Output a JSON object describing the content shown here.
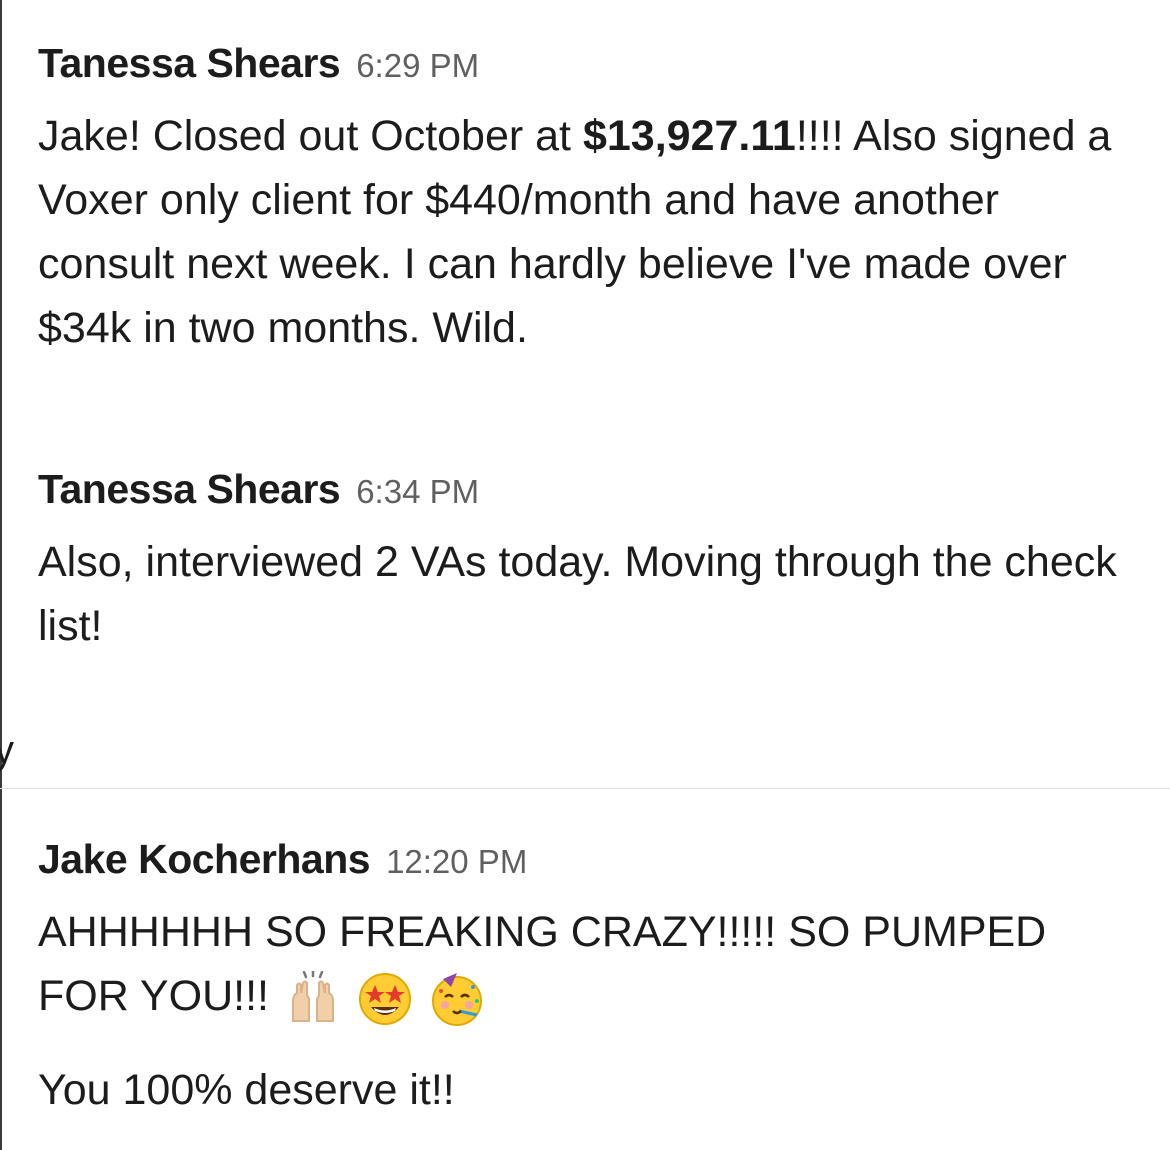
{
  "messages": [
    {
      "author": "Tanessa Shears",
      "time": "6:29 PM",
      "text_before_bold": "Jake! Closed out October at ",
      "bold_amount": "$13,927.11",
      "text_after_bold": "!!!! Also signed a Voxer only client for $440/month and have another consult next week. I can hardly believe I've made over $34k in two months. Wild."
    },
    {
      "author": "Tanessa Shears",
      "time": "6:34 PM",
      "text": "Also, interviewed 2 VAs today. Moving through the check list!"
    },
    {
      "author": "Jake Kocherhans",
      "time": "12:20 PM",
      "text": "AHHHHHH SO FREAKING CRAZY!!!!! SO PUMPED FOR YOU!!!",
      "emojis": [
        "raising-hands-emoji",
        "star-struck-emoji",
        "partying-face-emoji"
      ],
      "follow_up": "You 100% deserve it!!"
    }
  ],
  "edge_glyph": "y"
}
